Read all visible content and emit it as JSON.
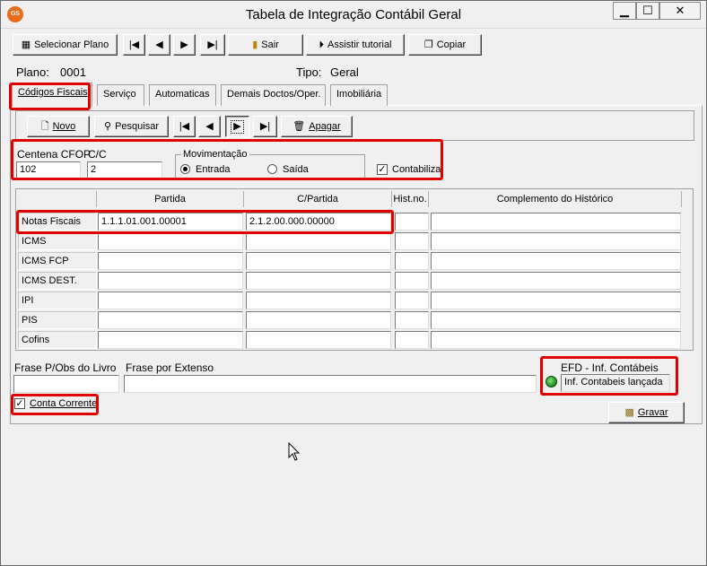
{
  "window": {
    "icon_text": "GS",
    "title": "Tabela de Integração Contábil Geral",
    "min_glyph": "▁",
    "max_glyph": "☐",
    "close_glyph": "✕"
  },
  "toolbar": {
    "selecionar_plano": "Selecionar Plano",
    "sair": "Sair",
    "assistir_tutorial": "Assistir tutorial",
    "copiar": "Copiar",
    "nav_first": "|◀",
    "nav_prev": "◀",
    "nav_next": "▶",
    "nav_last": "▶|"
  },
  "plan_info": {
    "plano_label": "Plano:",
    "plano_value": "0001",
    "tipo_label": "Tipo:",
    "tipo_value": "Geral"
  },
  "tabs": [
    {
      "label": "Códigos Fiscais",
      "active": true
    },
    {
      "label": "Serviço",
      "active": false
    },
    {
      "label": "Automaticas",
      "active": false
    },
    {
      "label": "Demais Doctos/Oper.",
      "active": false
    },
    {
      "label": "Imobiliária",
      "active": false
    }
  ],
  "record_nav": {
    "novo": "Novo",
    "pesquisar": "Pesquisar",
    "apagar": "Apagar"
  },
  "form": {
    "centena_cfop_label": "Centena CFOP",
    "centena_cfop_value": "102",
    "cc_label": "C/C",
    "cc_value": "2",
    "movimentacao_label": "Movimentação",
    "entrada_label": "Entrada",
    "saida_label": "Saída",
    "movimentacao_selected": "Entrada",
    "contabiliza_label": "Contabiliza",
    "contabiliza_checked": true
  },
  "grid": {
    "columns": [
      "Partida",
      "C/Partida",
      "Hist.no.",
      "Complemento do Histórico"
    ],
    "rows": [
      {
        "label": "Notas Fiscais",
        "partida": "1.1.1.01.001.00001",
        "cpartida": "2.1.2.00.000.00000",
        "hist": "",
        "complemento": ""
      },
      {
        "label": "ICMS",
        "partida": "",
        "cpartida": "",
        "hist": "",
        "complemento": ""
      },
      {
        "label": "ICMS FCP",
        "partida": "",
        "cpartida": "",
        "hist": "",
        "complemento": ""
      },
      {
        "label": "ICMS DEST.",
        "partida": "",
        "cpartida": "",
        "hist": "",
        "complemento": ""
      },
      {
        "label": "IPI",
        "partida": "",
        "cpartida": "",
        "hist": "",
        "complemento": ""
      },
      {
        "label": "PIS",
        "partida": "",
        "cpartida": "",
        "hist": "",
        "complemento": ""
      },
      {
        "label": "Cofins",
        "partida": "",
        "cpartida": "",
        "hist": "",
        "complemento": ""
      }
    ]
  },
  "bottom": {
    "frase_obs_label": "Frase P/Obs do Livro",
    "frase_obs_value": "",
    "frase_extenso_label": "Frase por Extenso",
    "frase_extenso_value": "",
    "efd_label": "EFD - Inf. Contábeis",
    "efd_status": "Inf. Contabeis lançada",
    "conta_corrente_label": "Conta Corrente",
    "conta_corrente_checked": true,
    "gravar": "Gravar"
  },
  "colors": {
    "highlight": "#e00000",
    "window_bg": "#f0f0f0",
    "status_green": "#1c8a1c"
  }
}
